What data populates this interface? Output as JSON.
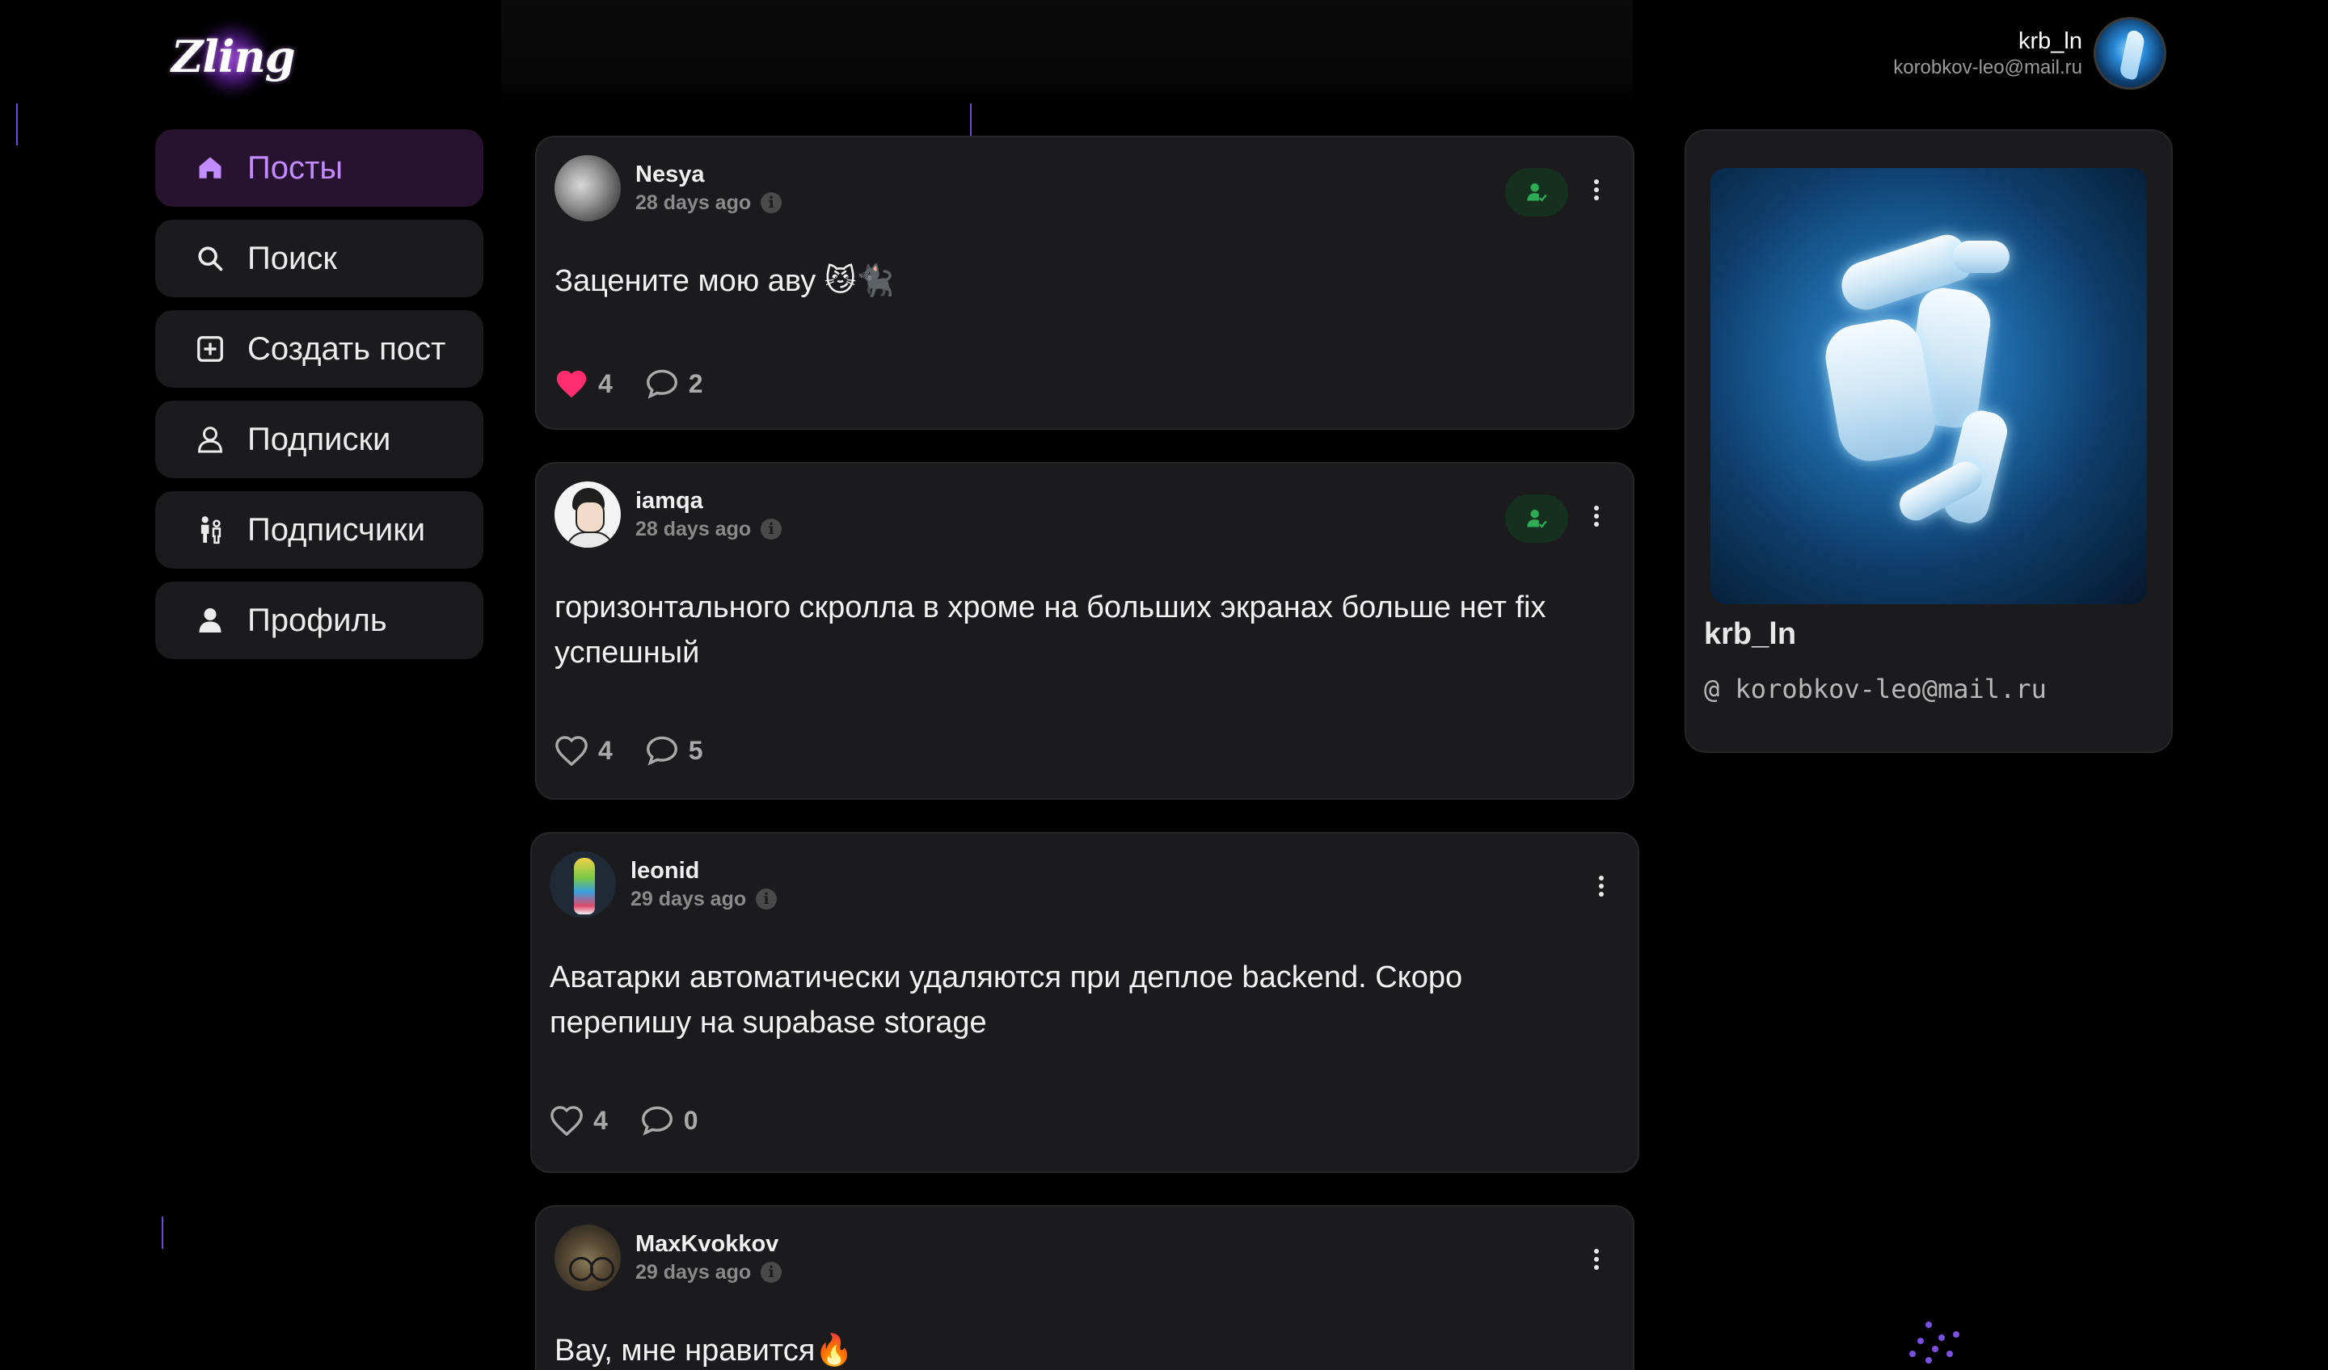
{
  "header": {
    "logo_text": "Zling",
    "user_name": "krb_ln",
    "user_email": "korobkov-leo@mail.ru"
  },
  "nav": {
    "items": [
      {
        "label": "Посты",
        "icon": "home-icon",
        "active": true
      },
      {
        "label": "Поиск",
        "icon": "search-icon",
        "active": false
      },
      {
        "label": "Создать пост",
        "icon": "plus-square-icon",
        "active": false
      },
      {
        "label": "Подписки",
        "icon": "user-outline-icon",
        "active": false
      },
      {
        "label": "Подписчики",
        "icon": "people-icon",
        "active": false
      },
      {
        "label": "Профиль",
        "icon": "user-filled-icon",
        "active": false
      }
    ]
  },
  "posts": [
    {
      "user": "Nesya",
      "time": "28 days ago",
      "text": "Зацените мою аву 😼🐈‍⬛",
      "likes": "4",
      "comments": "2",
      "liked": true,
      "following": true
    },
    {
      "user": "iamqa",
      "time": "28 days ago",
      "text": "горизонтального скролла в хроме на больших экранах больше нет fix успешный",
      "likes": "4",
      "comments": "5",
      "liked": false,
      "following": true
    },
    {
      "user": "leonid",
      "time": "29 days ago",
      "text": "Аватарки автоматически удаляются при деплое backend. Скоро перепишу на supabase storage",
      "likes": "4",
      "comments": "0",
      "liked": false,
      "following": false
    },
    {
      "user": "MaxKvokkov",
      "time": "29 days ago",
      "text": "Вау, мне нравится🔥",
      "likes": "",
      "comments": "",
      "liked": false,
      "following": false
    }
  ],
  "profile": {
    "name": "krb_ln",
    "email_prefix": "@",
    "email": "korobkov-leo@mail.ru"
  },
  "colors": {
    "accent": "#c28bff",
    "like": "#ff2d6f",
    "follow_badge_bg": "#15301f",
    "follow_badge_icon": "#2faa55"
  }
}
